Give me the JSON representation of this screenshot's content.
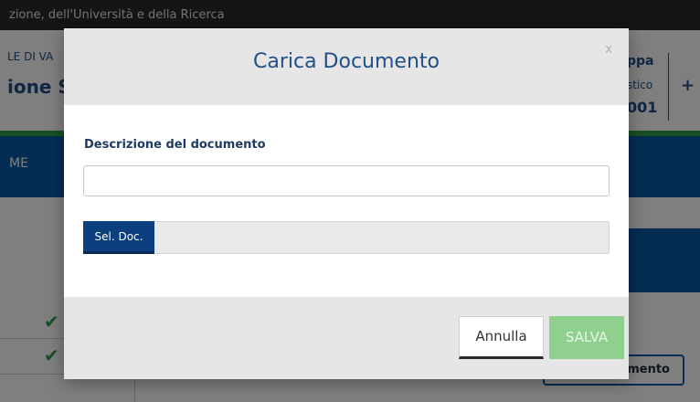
{
  "background": {
    "topbar_text": "zione, dell'Università e della Ricerca",
    "header_small": "LE DI VA",
    "header_big": "ione S",
    "user": {
      "name_fragment": "ppa",
      "role_fragment": "stico",
      "code_fragment": "001"
    },
    "header_action_glyph": "+",
    "nav_item": "ME",
    "doc_button_fragment": "umento",
    "check_glyph": "✔"
  },
  "modal": {
    "title": "Carica Documento",
    "close_label": "x",
    "description_label": "Descrizione del documento",
    "description_value": "",
    "description_placeholder": "",
    "file_button_label": "Sel. Doc.",
    "file_name": "",
    "cancel_label": "Annulla",
    "save_label": "SALVA"
  },
  "colors": {
    "brand_blue": "#1f4f86",
    "nav_blue": "#0b5aa6",
    "accent_green": "#2e9e4a",
    "save_disabled_green": "#8fd08e"
  }
}
